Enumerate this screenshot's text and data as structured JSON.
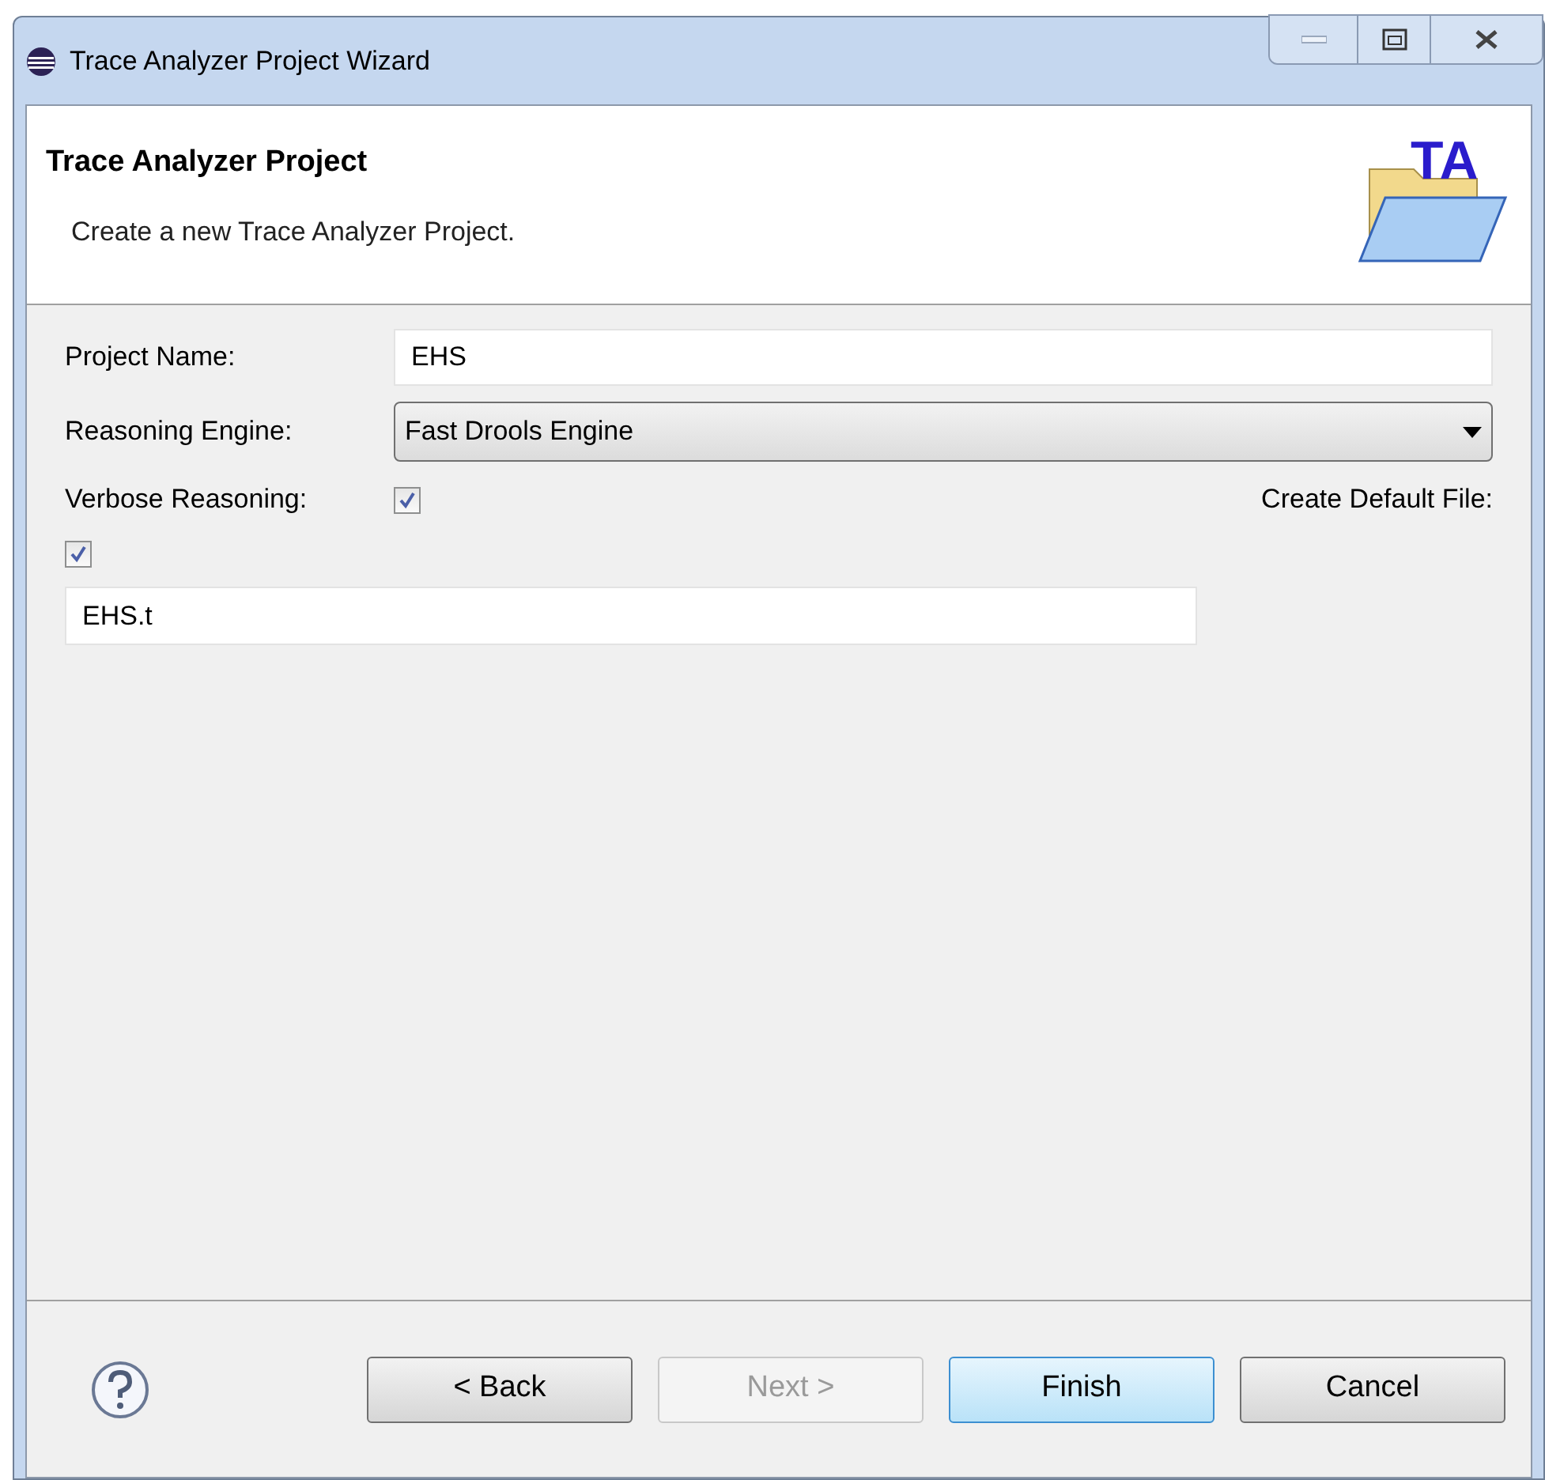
{
  "window": {
    "title": "Trace Analyzer Project Wizard"
  },
  "header": {
    "title": "Trace Analyzer Project",
    "description": "Create a new Trace Analyzer Project.",
    "logo_text": "TA"
  },
  "form": {
    "project_name": {
      "label": "Project Name:",
      "value": "EHS"
    },
    "engine": {
      "label": "Reasoning Engine:",
      "value": "Fast Drools Engine"
    },
    "verbose": {
      "label": "Verbose Reasoning:",
      "checked": true
    },
    "default_file": {
      "label": "Create Default File:",
      "checked": true,
      "value": "EHS.t"
    }
  },
  "buttons": [
    {
      "label": "< Back",
      "disabled": false,
      "selected": false
    },
    {
      "label": "Next >",
      "disabled": true,
      "selected": false
    },
    {
      "label": "Finish",
      "disabled": false,
      "selected": true
    },
    {
      "label": "Cancel",
      "disabled": false,
      "selected": false
    }
  ]
}
